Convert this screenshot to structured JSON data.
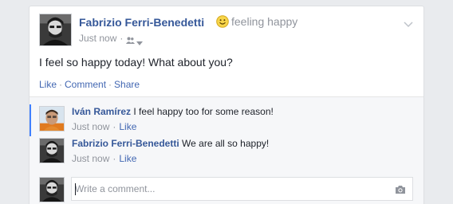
{
  "post": {
    "author": "Fabrizio Ferri-Benedetti",
    "feeling": "feeling happy",
    "timestamp": "Just now",
    "separator": "·",
    "text": "I feel so happy today! What about you?",
    "actions": {
      "like": "Like",
      "comment": "Comment",
      "share": "Share",
      "separator": "·"
    }
  },
  "comments": [
    {
      "author": "Iván Ramírez",
      "text": "I feel happy too for some reason!",
      "timestamp": "Just now",
      "like": "Like",
      "separator": "·"
    },
    {
      "author": "Fabrizio Ferri-Benedetti",
      "text": "We are all so happy!",
      "timestamp": "Just now",
      "like": "Like",
      "separator": "·"
    }
  ],
  "composer": {
    "placeholder": "Write a comment..."
  },
  "icons": {
    "smiley": "smiley-emoji-icon",
    "audience": "friends-audience-icon",
    "chevron": "chevron-down-icon",
    "camera": "camera-icon"
  },
  "colors": {
    "link": "#365899",
    "action_link": "#4267b2",
    "meta_gray": "#90949c",
    "background": "#e9ebee",
    "comment_bg": "#f6f7f9",
    "highlight_border": "#4080ff"
  }
}
